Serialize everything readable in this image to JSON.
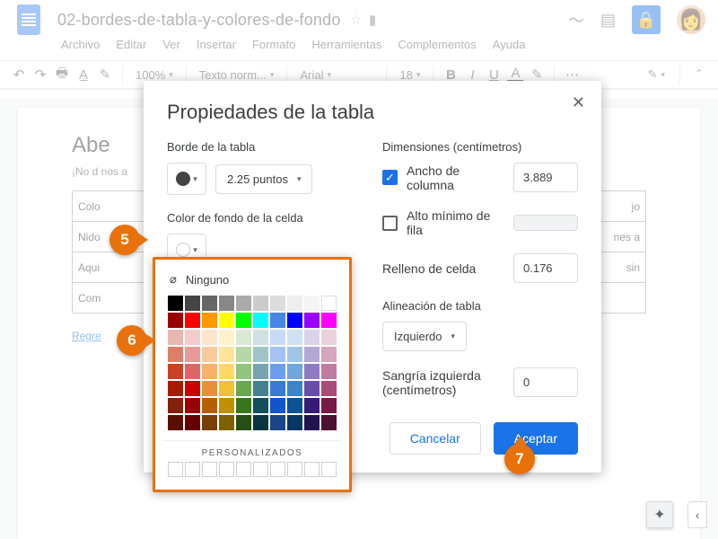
{
  "header": {
    "doc_title": "02-bordes-de-tabla-y-colores-de-fondo",
    "menus": [
      "Archivo",
      "Editar",
      "Ver",
      "Insertar",
      "Formato",
      "Herramientas",
      "Complementos",
      "Ayuda"
    ]
  },
  "toolbar": {
    "zoom": "100%",
    "style": "Texto norm...",
    "font": "Arial",
    "size": "18"
  },
  "doc": {
    "heading": "Abe",
    "sub": "¡No d\nnos a",
    "rows": [
      [
        "Colo",
        ""
      ],
      [
        "Nido",
        ""
      ],
      [
        "Aqui",
        ""
      ],
      [
        "Com",
        ""
      ]
    ],
    "rows_right": [
      "jo",
      "",
      "nes\na",
      "sin",
      ""
    ],
    "link": "Regre"
  },
  "dialog": {
    "title": "Propiedades de la tabla",
    "border_label": "Borde de la tabla",
    "border_width": "2.25 puntos",
    "bgcolor_label": "Color de fondo de la celda",
    "dims_label": "Dimensiones  (centímetros)",
    "col_width_label": "Ancho de columna",
    "col_width_value": "3.889",
    "row_height_label": "Alto mínimo de fila",
    "row_height_value": "",
    "padding_label": "Relleno de celda",
    "padding_value": "0.176",
    "align_label": "Alineación de tabla",
    "align_value": "Izquierdo",
    "indent_label": "Sangría izquierda  (centímetros)",
    "indent_value": "0",
    "cancel": "Cancelar",
    "accept": "Aceptar"
  },
  "picker": {
    "none": "Ninguno",
    "custom_label": "PERSONALIZADOS",
    "colors_row0": [
      "#000000",
      "#444444",
      "#666666",
      "#888888",
      "#aaaaaa",
      "#cccccc",
      "#dddddd",
      "#eeeeee",
      "#f5f5f5",
      "#ffffff"
    ],
    "colors_row1": [
      "#990000",
      "#ff0000",
      "#ff9900",
      "#ffff00",
      "#00ff00",
      "#00ffff",
      "#4a86e8",
      "#0000ff",
      "#9900ff",
      "#ff00ff"
    ],
    "colors_row2": [
      "#e6b8af",
      "#f4cccc",
      "#fce5cd",
      "#fff2cc",
      "#d9ead3",
      "#d0e0e3",
      "#c9daf8",
      "#cfe2f3",
      "#d9d2e9",
      "#ead1dc"
    ],
    "colors_row3": [
      "#dd7e6b",
      "#ea9999",
      "#f9cb9c",
      "#ffe599",
      "#b6d7a8",
      "#a2c4c9",
      "#a4c2f4",
      "#9fc5e8",
      "#b4a7d6",
      "#d5a6bd"
    ],
    "colors_row4": [
      "#cc4125",
      "#e06666",
      "#f6b26b",
      "#ffd966",
      "#93c47d",
      "#76a5af",
      "#6d9eeb",
      "#6fa8dc",
      "#8e7cc3",
      "#c27ba0"
    ],
    "colors_row5": [
      "#a61c00",
      "#cc0000",
      "#e69138",
      "#f1c232",
      "#6aa84f",
      "#45818e",
      "#3c78d8",
      "#3d85c6",
      "#674ea7",
      "#a64d79"
    ],
    "colors_row6": [
      "#85200c",
      "#990000",
      "#b45f06",
      "#bf9000",
      "#38761d",
      "#134f5c",
      "#1155cc",
      "#0b5394",
      "#351c75",
      "#741b47"
    ],
    "colors_row7": [
      "#5b0f00",
      "#660000",
      "#783f04",
      "#7f6000",
      "#274e13",
      "#0c343d",
      "#1c4587",
      "#073763",
      "#20124d",
      "#4c1130"
    ]
  },
  "callouts": {
    "c5": "5",
    "c6": "6",
    "c7": "7"
  }
}
